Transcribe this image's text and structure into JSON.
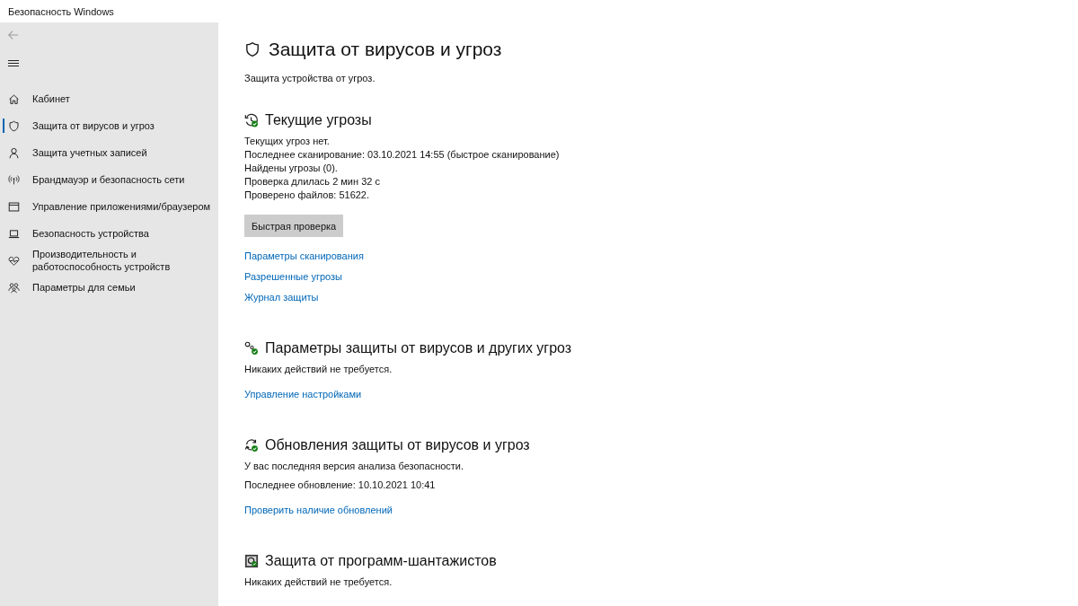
{
  "window": {
    "title": "Безопасность Windows"
  },
  "sidebar": {
    "items": [
      {
        "kind": "home",
        "label": "Кабинет",
        "selected": false
      },
      {
        "kind": "shield",
        "label": "Защита от вирусов и угроз",
        "selected": true
      },
      {
        "kind": "person",
        "label": "Защита учетных записей",
        "selected": false
      },
      {
        "kind": "antenna",
        "label": "Брандмауэр и безопасность сети",
        "selected": false
      },
      {
        "kind": "window",
        "label": "Управление приложениями/браузером",
        "selected": false
      },
      {
        "kind": "laptop",
        "label": "Безопасность устройства",
        "selected": false
      },
      {
        "kind": "heart",
        "label": "Производительность и работоспособность устройств",
        "selected": false
      },
      {
        "kind": "family",
        "label": "Параметры для семьи",
        "selected": false
      }
    ]
  },
  "page": {
    "title": "Защита от вирусов и угроз",
    "subtitle": "Защита устройства от угроз."
  },
  "sections": [
    {
      "kind": "history",
      "title": "Текущие угрозы",
      "lines": [
        "Текущих угроз нет.",
        "Последнее сканирование: 03.10.2021 14:55 (быстрое сканирование)",
        "Найдены угрозы (0).",
        "Проверка длилась 2 мин 32 с",
        "Проверено файлов: 51622."
      ],
      "button": "Быстрая проверка",
      "links": [
        "Параметры сканирования",
        "Разрешенные угрозы",
        "Журнал защиты"
      ]
    },
    {
      "kind": "gears",
      "title": "Параметры защиты от вирусов и других угроз",
      "lines": [
        "Никаких действий не требуется."
      ],
      "links": [
        "Управление настройками"
      ]
    },
    {
      "kind": "refresh",
      "title": "Обновления защиты от вирусов и угроз",
      "lines": [
        "У вас последняя версия анализа безопасности.",
        "Последнее обновление: 10.10.2021 10:41"
      ],
      "links": [
        "Проверить наличие обновлений"
      ]
    },
    {
      "kind": "vault",
      "title": "Защита от программ-шантажистов",
      "lines": [
        "Никаких действий не требуется."
      ]
    }
  ]
}
